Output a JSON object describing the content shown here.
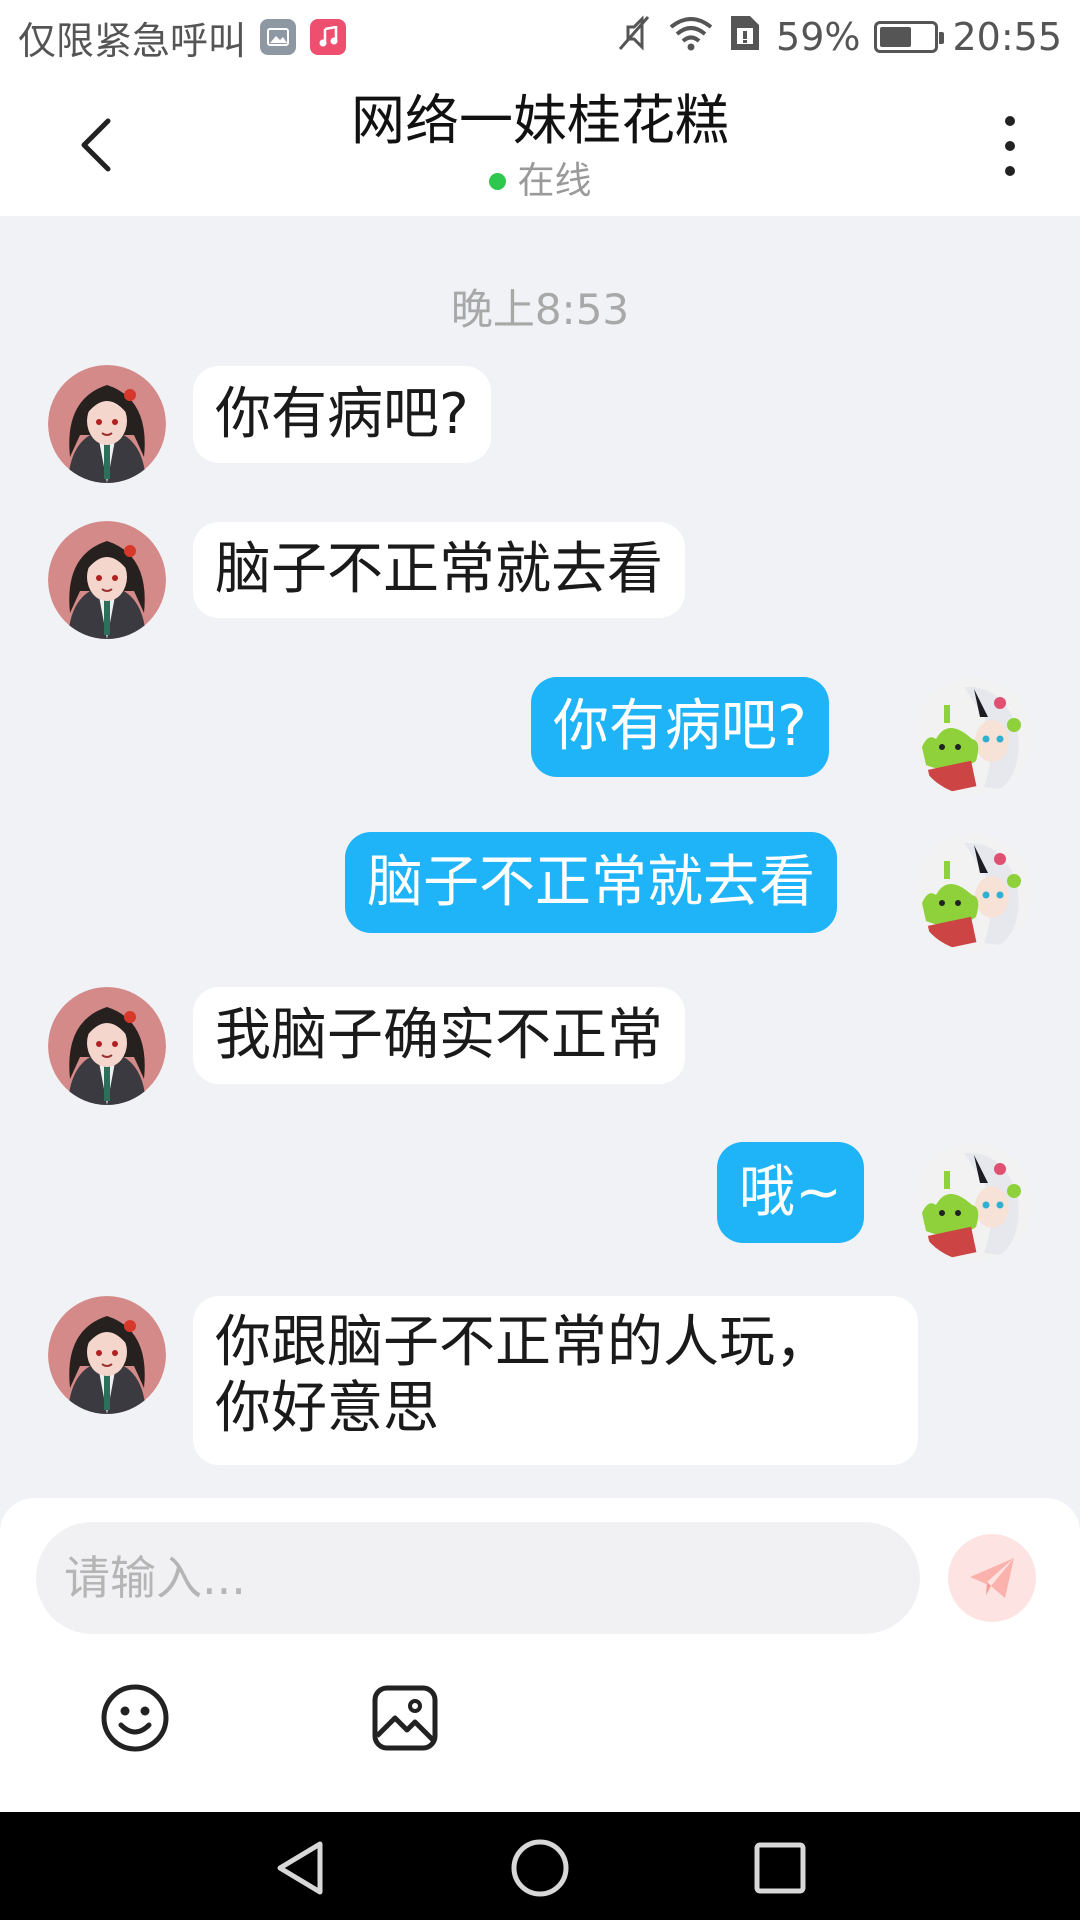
{
  "status_bar": {
    "carrier_text": "仅限紧急呼叫",
    "icons": [
      "gallery-icon",
      "music-icon",
      "mute-icon",
      "wifi-icon",
      "sim-icon",
      "battery-icon"
    ],
    "battery_percent": "59%",
    "battery_level": 0.59,
    "time": "20:55"
  },
  "header": {
    "title": "网络一妹桂花糕",
    "presence": "在线",
    "presence_color": "#2dc84d"
  },
  "chat": {
    "timestamp": "晚上8:53",
    "messages": [
      {
        "from": "contact",
        "text": "你有病吧?"
      },
      {
        "from": "contact",
        "text": "脑子不正常就去看"
      },
      {
        "from": "me",
        "text": "你有病吧?"
      },
      {
        "from": "me",
        "text": "脑子不正常就去看"
      },
      {
        "from": "contact",
        "text": "我脑子确实不正常"
      },
      {
        "from": "me",
        "text": "哦~"
      },
      {
        "from": "contact",
        "line1": "你跟脑子不正常的人玩，",
        "line2": "你好意思"
      }
    ],
    "colors": {
      "incoming_bubble": "#ffffff",
      "outgoing_bubble": "#1fb3f8",
      "background": "#f1f2f6"
    }
  },
  "composer": {
    "placeholder": "请输入...",
    "value": "",
    "tools": [
      "emoji-icon",
      "image-icon"
    ],
    "send_icon": "paper-plane-icon"
  },
  "nav_bar": {
    "buttons": [
      "back-triangle-icon",
      "home-circle-icon",
      "recents-square-icon"
    ]
  }
}
